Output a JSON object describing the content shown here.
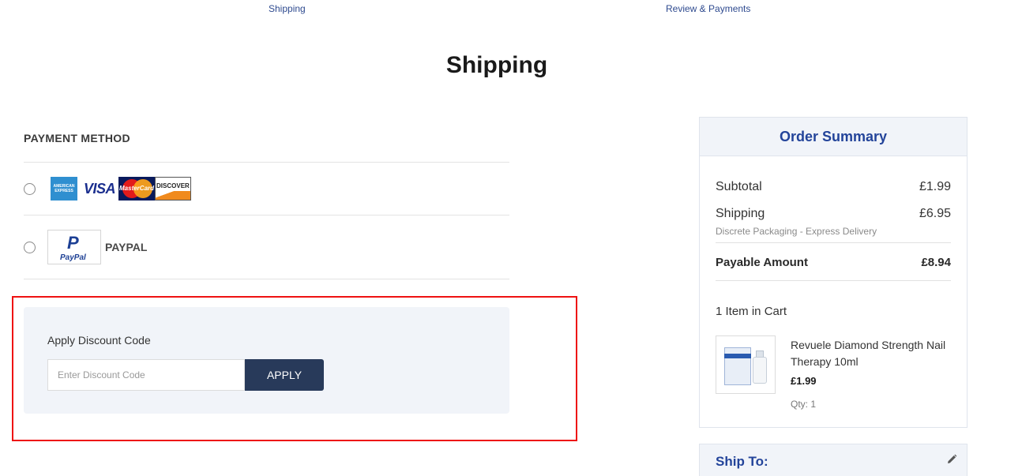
{
  "steps": {
    "shipping": "Shipping",
    "review": "Review & Payments"
  },
  "page_title": "Shipping",
  "payment": {
    "title": "PAYMENT METHOD",
    "card_logos": {
      "amex_line1": "AMERICAN",
      "amex_line2": "EXPRESS",
      "visa": "VISA",
      "mastercard": "MasterCard",
      "discover": "DISCOVER"
    },
    "paypal_logo_text": "PayPal",
    "paypal_label": "PAYPAL"
  },
  "discount": {
    "label": "Apply Discount Code",
    "placeholder": "Enter Discount Code",
    "button": "APPLY"
  },
  "summary": {
    "title": "Order Summary",
    "subtotal_label": "Subtotal",
    "subtotal_value": "£1.99",
    "shipping_label": "Shipping",
    "shipping_value": "£6.95",
    "shipping_note": "Discrete Packaging - Express Delivery",
    "payable_label": "Payable Amount",
    "payable_value": "£8.94",
    "items_count": "1 Item in Cart",
    "item": {
      "name": "Revuele Diamond Strength Nail Therapy 10ml",
      "price": "£1.99",
      "qty": "Qty: 1"
    }
  },
  "ship_to": {
    "title": "Ship To:"
  },
  "colors": {
    "brand_blue": "#23449a",
    "button_dark": "#283a5a",
    "highlight_red": "#ee1111",
    "panel_bg": "#f1f4f9"
  }
}
